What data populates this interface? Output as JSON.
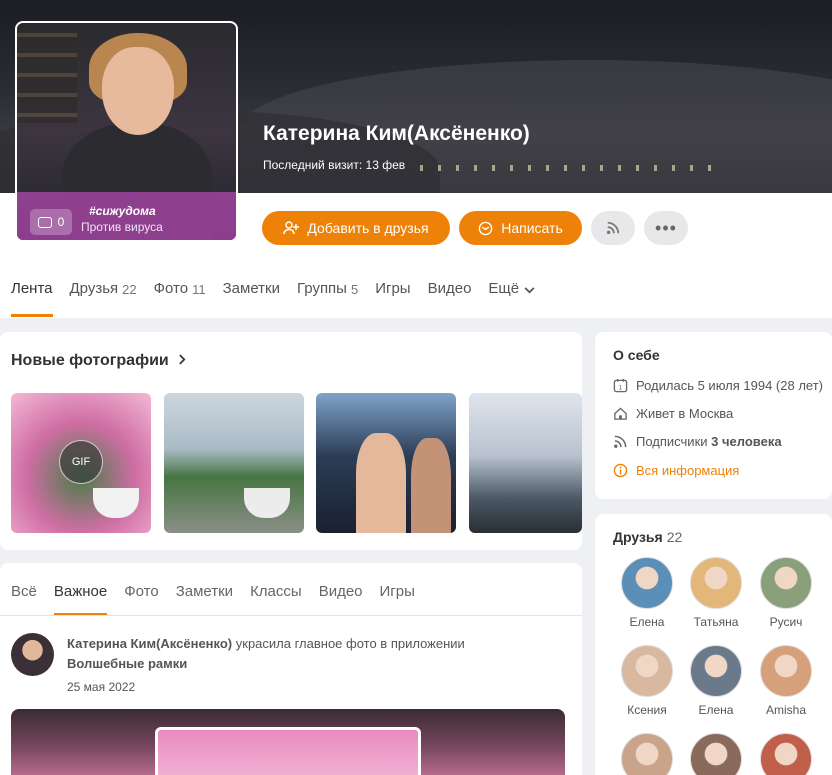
{
  "profile": {
    "name": "Катерина Ким(Аксёненко)",
    "last_visit": "Последний визит: 13 фев",
    "avatar_tag": "#сижудома",
    "avatar_sub": "Против вируса",
    "avatar_comments": "0"
  },
  "actions": {
    "add_friend": "Добавить в друзья",
    "message": "Написать"
  },
  "tabs": [
    {
      "label": "Лента",
      "count": ""
    },
    {
      "label": "Друзья",
      "count": "22"
    },
    {
      "label": "Фото",
      "count": "11"
    },
    {
      "label": "Заметки",
      "count": ""
    },
    {
      "label": "Группы",
      "count": "5"
    },
    {
      "label": "Игры",
      "count": ""
    },
    {
      "label": "Видео",
      "count": ""
    },
    {
      "label": "Ещё",
      "count": ""
    }
  ],
  "photos": {
    "title": "Новые фотографии",
    "gif_label": "GIF"
  },
  "feed_tabs": [
    "Всё",
    "Важное",
    "Фото",
    "Заметки",
    "Классы",
    "Видео",
    "Игры"
  ],
  "post": {
    "author": "Катерина Ким(Аксёненко)",
    "action": " украсила главное фото в приложении",
    "app": "Волшебные рамки",
    "date": "25 мая 2022"
  },
  "about": {
    "title": "О себе",
    "born": "Родилась 5 июля 1994 (28 лет)",
    "lives": "Живет в Москва",
    "subscribers_prefix": "Подписчики ",
    "subscribers_count": "3 человека",
    "all_info": "Вся информация"
  },
  "friends": {
    "title": "Друзья",
    "count": "22",
    "items": [
      {
        "name": "Елена",
        "color": "#5b8fb8"
      },
      {
        "name": "Татьяна",
        "color": "#e3b77a"
      },
      {
        "name": "Русич",
        "color": "#8aa07a"
      },
      {
        "name": "Ксения",
        "color": "#d9b8a0"
      },
      {
        "name": "Елена",
        "color": "#6b7a8a"
      },
      {
        "name": "Amisha",
        "color": "#d6a07a"
      },
      {
        "name": "",
        "color": "#c9a48a"
      },
      {
        "name": "",
        "color": "#8a6a5a"
      },
      {
        "name": "",
        "color": "#c0604a"
      }
    ]
  },
  "accent_color": "#ee8208"
}
